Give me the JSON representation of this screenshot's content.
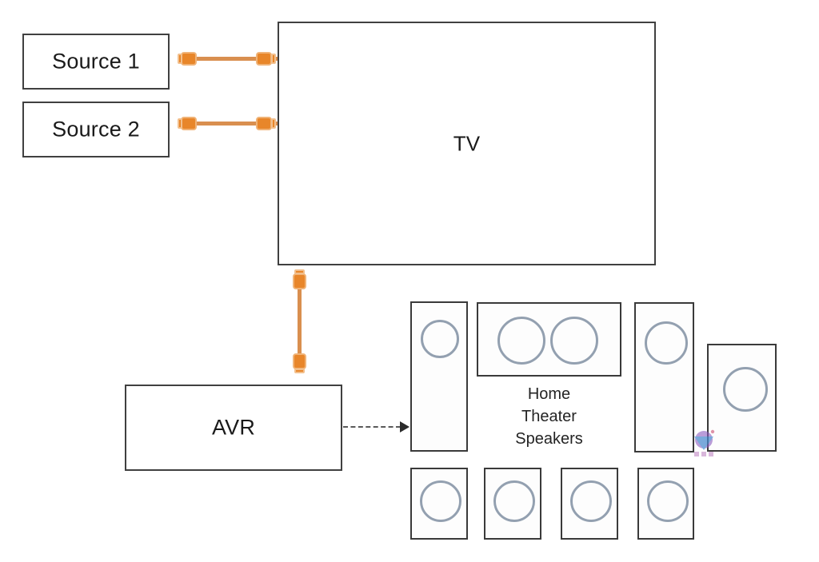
{
  "diagram": {
    "title_text_visible": false,
    "background_color": "#ffffff",
    "line_color": "#3f3f3f",
    "cable_color": "#e8862a",
    "driver_color": "#93a0b0",
    "arrow_color": "#2b2b2b"
  },
  "devices": [
    {
      "id": "source1",
      "label": "Source 1"
    },
    {
      "id": "source2",
      "label": "Source 2"
    },
    {
      "id": "tv",
      "label": "TV"
    },
    {
      "id": "avr",
      "label": "AVR"
    }
  ],
  "labels": {
    "source1": "Source 1",
    "source2": "Source 2",
    "tv": "TV",
    "avr": "AVR",
    "speakers_line1": "Home",
    "speakers_line2": "Theater",
    "speakers_line3": "Speakers"
  },
  "connections": [
    {
      "id": "hdmi-source1-tv",
      "type": "hdmi-cable",
      "from": "Source 1",
      "to": "TV",
      "orientation": "horizontal"
    },
    {
      "id": "hdmi-source2-tv",
      "type": "hdmi-cable",
      "from": "Source 2",
      "to": "TV",
      "orientation": "horizontal"
    },
    {
      "id": "hdmi-tv-avr",
      "type": "hdmi-cable",
      "from": "TV",
      "to": "AVR",
      "orientation": "vertical"
    },
    {
      "id": "avr-speakers",
      "type": "dashed-arrow",
      "from": "AVR",
      "to": "Home Theater Speakers",
      "orientation": "horizontal"
    }
  ],
  "speakers": {
    "group_label": "Home Theater Speakers",
    "items": [
      {
        "id": "front-left",
        "shape": "tall",
        "drivers": 1
      },
      {
        "id": "center",
        "shape": "wide",
        "drivers": 2
      },
      {
        "id": "front-right",
        "shape": "tall",
        "drivers": 1
      },
      {
        "id": "subwoofer",
        "shape": "medium",
        "drivers": 1
      },
      {
        "id": "surround-1",
        "shape": "small",
        "drivers": 1
      },
      {
        "id": "surround-2",
        "shape": "small",
        "drivers": 1
      },
      {
        "id": "surround-3",
        "shape": "small",
        "drivers": 1
      },
      {
        "id": "surround-4",
        "shape": "small",
        "drivers": 1
      }
    ],
    "count": 8
  },
  "watermark": {
    "present": true,
    "colors": [
      "#8b5bbf",
      "#3f8fd0",
      "#b06ab3"
    ]
  }
}
